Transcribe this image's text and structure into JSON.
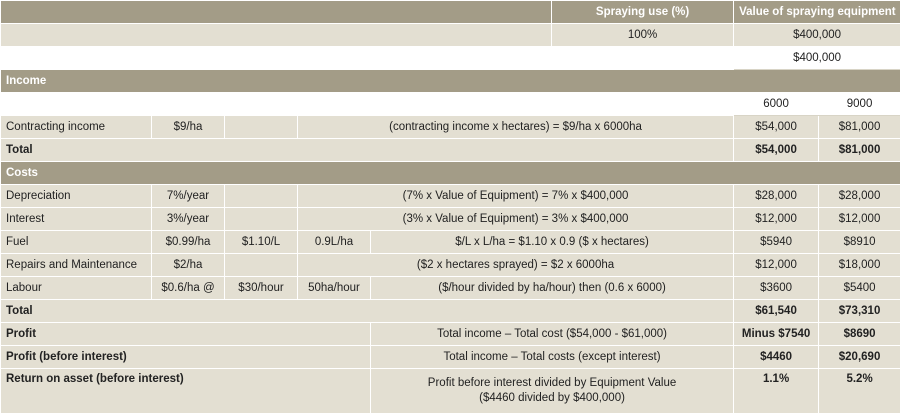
{
  "header": {
    "spraying_use_label": "Spraying use (%)",
    "equipment_value_label": "Value of spraying equipment",
    "spraying_use_value": "100%",
    "equipment_value_1": "$400,000",
    "equipment_value_2": "$400,000"
  },
  "income": {
    "section_label": "Income",
    "hectares": [
      "6000",
      "9000"
    ],
    "contracting": {
      "label": "Contracting income",
      "rate": "$9/ha",
      "formula": "(contracting income x hectares) = $9/ha x 6000ha",
      "values": [
        "$54,000",
        "$81,000"
      ]
    },
    "total": {
      "label": "Total",
      "values": [
        "$54,000",
        "$81,000"
      ]
    }
  },
  "costs": {
    "section_label": "Costs",
    "depreciation": {
      "label": "Depreciation",
      "rate": "7%/year",
      "formula": "(7% x Value of Equipment) = 7% x $400,000",
      "values": [
        "$28,000",
        "$28,000"
      ]
    },
    "interest": {
      "label": "Interest",
      "rate": "3%/year",
      "formula": "(3% x Value of Equipment) = 3% x $400,000",
      "values": [
        "$12,000",
        "$12,000"
      ]
    },
    "fuel": {
      "label": "Fuel",
      "rate": "$0.99/ha",
      "price": "$1.10/L",
      "usage": "0.9L/ha",
      "formula": "$/L x L/ha = $1.10 x 0.9 ($ x hectares)",
      "values": [
        "$5940",
        "$8910"
      ]
    },
    "repairs": {
      "label": "Repairs and Maintenance",
      "rate": "$2/ha",
      "formula": "($2 x hectares sprayed) = $2 x 6000ha",
      "values": [
        "$12,000",
        "$18,000"
      ]
    },
    "labour": {
      "label": "Labour",
      "rate": "$0.6/ha @",
      "price": "$30/hour",
      "usage": "50ha/hour",
      "formula": "($/hour divided by ha/hour) then (0.6 x 6000)",
      "values": [
        "$3600",
        "$5400"
      ]
    },
    "total": {
      "label": "Total",
      "values": [
        "$61,540",
        "$73,310"
      ]
    }
  },
  "results": {
    "profit": {
      "label": "Profit",
      "formula": "Total income – Total cost ($54,000 - $61,000)",
      "values": [
        "Minus $7540",
        "$8690"
      ]
    },
    "profit_before_interest": {
      "label": "Profit (before interest)",
      "formula": "Total income – Total costs (except interest)",
      "values": [
        "$4460",
        "$20,690"
      ]
    },
    "return_on_asset": {
      "label": "Return on asset (before interest)",
      "formula_line1": "Profit before interest divided by Equipment Value",
      "formula_line2": "($4460 divided by $400,000)",
      "values": [
        "1.1%",
        "5.2%"
      ]
    }
  }
}
